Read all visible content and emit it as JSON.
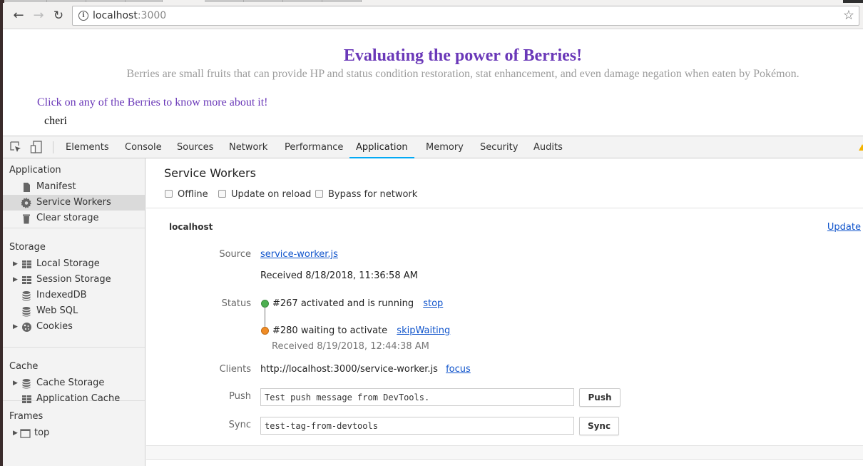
{
  "browser": {
    "url_host": "localhost",
    "url_port": ":3000",
    "back_icon": "arrow-left-icon",
    "forward_icon": "arrow-right-icon",
    "reload_icon": "reload-icon",
    "info_icon": "info-icon",
    "bookmark_icon": "star-icon"
  },
  "page": {
    "title": "Evaluating the power of Berries!",
    "subtitle": "Berries are small fruits that can provide HP and status condition restoration, stat enhancement, and even damage negation when eaten by Pokémon.",
    "hint": "Click on any of the Berries to know more about it!",
    "berries": [
      "cheri"
    ],
    "colors": {
      "accent": "#6a38b8",
      "muted": "#9c9c9c"
    }
  },
  "devtools": {
    "tabs": [
      {
        "label": "Elements"
      },
      {
        "label": "Console"
      },
      {
        "label": "Sources"
      },
      {
        "label": "Network"
      },
      {
        "label": "Performance"
      },
      {
        "label": "Application",
        "active": true
      },
      {
        "label": "Memory"
      },
      {
        "label": "Security"
      },
      {
        "label": "Audits"
      }
    ],
    "sidebar": {
      "sections": [
        {
          "title": "Application",
          "items": [
            {
              "label": "Manifest",
              "icon": "document-icon"
            },
            {
              "label": "Service Workers",
              "icon": "gear-icon",
              "selected": true
            },
            {
              "label": "Clear storage",
              "icon": "trash-icon"
            }
          ]
        },
        {
          "title": "Storage",
          "items": [
            {
              "label": "Local Storage",
              "icon": "grid-icon",
              "expandable": true
            },
            {
              "label": "Session Storage",
              "icon": "grid-icon",
              "expandable": true
            },
            {
              "label": "IndexedDB",
              "icon": "database-icon"
            },
            {
              "label": "Web SQL",
              "icon": "database-icon"
            },
            {
              "label": "Cookies",
              "icon": "cookie-icon",
              "expandable": true
            }
          ]
        },
        {
          "title": "Cache",
          "items": [
            {
              "label": "Cache Storage",
              "icon": "database-icon",
              "expandable": true
            },
            {
              "label": "Application Cache",
              "icon": "grid-icon"
            }
          ]
        },
        {
          "title": "Frames",
          "items": [
            {
              "label": "top",
              "icon": "frame-icon",
              "expandable": true
            }
          ]
        }
      ]
    },
    "service_workers": {
      "title": "Service Workers",
      "options": [
        {
          "label": "Offline",
          "checked": false
        },
        {
          "label": "Update on reload",
          "checked": false
        },
        {
          "label": "Bypass for network",
          "checked": false
        }
      ],
      "origin": "localhost",
      "update_label": "Update",
      "source_label": "Source",
      "source_file": "service-worker.js",
      "source_received": "Received 8/18/2018, 11:36:58 AM",
      "status_label": "Status",
      "status": [
        {
          "text": "#267 activated and is running",
          "action": "stop",
          "color": "#4caf50"
        },
        {
          "text": "#280 waiting to activate",
          "action": "skipWaiting",
          "color": "#f08c25",
          "received": "Received 8/19/2018, 12:44:38 AM"
        }
      ],
      "clients_label": "Clients",
      "client_url": "http://localhost:3000/service-worker.js",
      "client_action": "focus",
      "push_label": "Push",
      "push_value": "Test push message from DevTools.",
      "push_button": "Push",
      "sync_label": "Sync",
      "sync_value": "test-tag-from-devtools",
      "sync_button": "Sync"
    }
  }
}
